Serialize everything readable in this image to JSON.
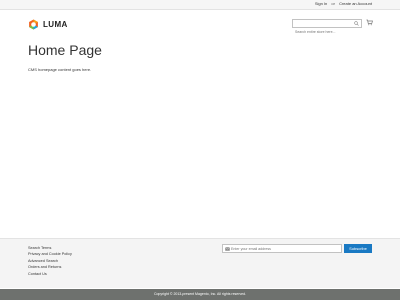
{
  "topbar": {
    "sign_in": "Sign In",
    "separator": "or",
    "create_account": "Create an Account"
  },
  "header": {
    "logo_text": "LUMA",
    "logo_icon": "luma-logo-icon",
    "search_placeholder": "Search entire store here...",
    "search_icon": "search-icon",
    "cart_icon": "cart-icon"
  },
  "main": {
    "title": "Home Page",
    "content": "CMS homepage content goes here."
  },
  "footer": {
    "links": [
      "Search Terms",
      "Privacy and Cookie Policy",
      "Advanced Search",
      "Orders and Returns",
      "Contact Us"
    ],
    "newsletter": {
      "placeholder": "Enter your email address",
      "button": "Subscribe",
      "icon": "mail-icon"
    }
  },
  "copyright": "Copyright © 2013-present Magento, Inc. All rights reserved.",
  "colors": {
    "accent": "#1979c3",
    "logo_orange": "#f26322",
    "copyright_bg": "#6e716e"
  }
}
